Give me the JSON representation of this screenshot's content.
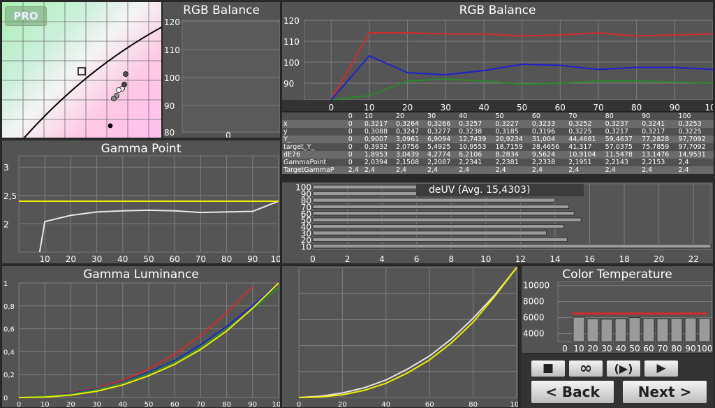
{
  "badge": "PRO",
  "rgb_small": {
    "title": "RGB Balance",
    "yticks": [
      "120",
      "110",
      "100",
      "90",
      "80"
    ],
    "xtick": "0"
  },
  "rgb_big": {
    "title": "RGB Balance",
    "yticks": [
      "120",
      "110",
      "100",
      "90"
    ],
    "xticks": [
      "0",
      "10",
      "20",
      "30",
      "40",
      "50",
      "60",
      "70",
      "80",
      "90",
      "100"
    ],
    "colors": {
      "red": "#d42a2a",
      "green": "#2a8a2a",
      "blue": "#1f1fcf"
    },
    "chart_data": {
      "type": "line",
      "x": [
        0,
        10,
        20,
        30,
        40,
        50,
        60,
        70,
        80,
        90,
        100
      ],
      "series": [
        {
          "color": "red",
          "values": [
            75,
            114,
            114,
            113.5,
            113.5,
            112.5,
            113,
            114,
            112.5,
            113,
            113.5
          ]
        },
        {
          "color": "green",
          "values": [
            75,
            84,
            91,
            92,
            91,
            89.5,
            90,
            91,
            91,
            90.5,
            90
          ]
        },
        {
          "color": "blue",
          "values": [
            75,
            103,
            95,
            94,
            96,
            99,
            98.5,
            96.5,
            97.5,
            97.5,
            96.5
          ]
        }
      ],
      "ylim": [
        80,
        120
      ]
    }
  },
  "stats": {
    "header": [
      "",
      "0",
      "10",
      "20",
      "30",
      "40",
      "50",
      "60",
      "70",
      "80",
      "90",
      "100"
    ],
    "rows": [
      [
        "x",
        "0",
        "0,3217",
        "0,3264",
        "0,3266",
        "0,3257",
        "0,3227",
        "0,3233",
        "0,3252",
        "0,3237",
        "0,3241",
        "0,3253"
      ],
      [
        "y",
        "0",
        "0,3088",
        "0,3247",
        "0,3277",
        "0,3238",
        "0,3185",
        "0,3196",
        "0,3225",
        "0,3217",
        "0,3217",
        "0,3225"
      ],
      [
        "Y_",
        "0",
        "0,9007",
        "3,0961",
        "6,9094",
        "12,7439",
        "20,9234",
        "31,004",
        "44,4681",
        "59,4637",
        "77,2828",
        "97,7092"
      ],
      [
        "target_Y_",
        "0",
        "0,3932",
        "2,0756",
        "5,4925",
        "10,9553",
        "18,7159",
        "28,4656",
        "41,317",
        "57,0375",
        "75,7859",
        "97,7092"
      ],
      [
        "dE76",
        "0",
        "1,8953",
        "3,0439",
        "4,2774",
        "6,2106",
        "8,2834",
        "9,5624",
        "10,9104",
        "11,5478",
        "13,1476",
        "14,9531"
      ],
      [
        "GammaPoint",
        "0",
        "2,0394",
        "2,1508",
        "2,2087",
        "2,2341",
        "2,2381",
        "2,2338",
        "2,1951",
        "2,2143",
        "2,2153",
        "2,4"
      ],
      [
        "TargetGammaP",
        "2,4",
        "2,4",
        "2,4",
        "2,4",
        "2,4",
        "2,4",
        "2,4",
        "2,4",
        "2,4",
        "2,4",
        "2,4"
      ]
    ]
  },
  "deuv": {
    "title": "deUV (Avg. 15,4303)",
    "yticks": [
      "100",
      "90",
      "80",
      "70",
      "60",
      "50",
      "40",
      "30",
      "20",
      "10"
    ],
    "xticks": [
      "0",
      "2",
      "4",
      "6",
      "8",
      "10",
      "12",
      "14",
      "16",
      "18",
      "20",
      "22"
    ],
    "chart_data": {
      "type": "bar",
      "categories": [
        "100",
        "90",
        "80",
        "70",
        "60",
        "50",
        "40",
        "30",
        "20",
        "10"
      ],
      "values": [
        10.3,
        10.3,
        14,
        14.8,
        15.1,
        15.5,
        14.5,
        13.5,
        14.7,
        23
      ],
      "xlim": [
        0,
        23
      ]
    }
  },
  "gamma_point": {
    "title": "Gamma Point",
    "yticks": [
      "3",
      "2,5",
      "2"
    ],
    "xticks": [
      "10",
      "20",
      "30",
      "40",
      "50",
      "60",
      "70",
      "80",
      "90",
      "100"
    ],
    "chart_data": {
      "type": "line",
      "x": [
        8,
        10,
        20,
        30,
        40,
        50,
        60,
        70,
        80,
        90,
        100
      ],
      "series": [
        {
          "name": "",
          "color": "#e8e8e8",
          "values": [
            1.5,
            2.04,
            2.15,
            2.21,
            2.23,
            2.24,
            2.23,
            2.2,
            2.21,
            2.22,
            2.4
          ]
        },
        {
          "name": "",
          "color": "#f0f000",
          "values": [
            2.4,
            2.4,
            2.4,
            2.4,
            2.4,
            2.4,
            2.4,
            2.4,
            2.4,
            2.4,
            2.4
          ]
        }
      ],
      "ylim": [
        1.5,
        3.2
      ],
      "xlim": [
        0,
        100
      ]
    }
  },
  "gamma_lum": {
    "title": "Gamma Luminance",
    "yticks": [
      "1",
      "0,8",
      "0,6",
      "0,4",
      "0,2",
      "0"
    ],
    "xticks": [
      "0",
      "10",
      "20",
      "30",
      "40",
      "50",
      "60",
      "70",
      "80",
      "90",
      "100"
    ],
    "chart_data": {
      "type": "line",
      "x": [
        0,
        10,
        20,
        30,
        40,
        50,
        60,
        70,
        80,
        90,
        100
      ],
      "series": [
        {
          "color": "#d42a2a",
          "values": [
            0,
            0.01,
            0.04,
            0.08,
            0.15,
            0.25,
            0.38,
            0.54,
            0.74,
            0.97,
            1.2
          ]
        },
        {
          "color": "#1f1fcf",
          "values": [
            0,
            0.01,
            0.035,
            0.075,
            0.135,
            0.22,
            0.32,
            0.46,
            0.62,
            0.8,
            1.0
          ]
        },
        {
          "color": "#2a8a2a",
          "values": [
            0,
            0.01,
            0.03,
            0.07,
            0.13,
            0.21,
            0.31,
            0.44,
            0.6,
            0.77,
            0.96
          ]
        },
        {
          "color": "#f0f000",
          "values": [
            0,
            0.004,
            0.021,
            0.055,
            0.11,
            0.19,
            0.29,
            0.42,
            0.58,
            0.78,
            1.0
          ]
        }
      ],
      "ylim": [
        0,
        1
      ],
      "xlim": [
        0,
        100
      ]
    }
  },
  "lum2": {
    "xticks": [
      "0",
      "20",
      "40",
      "60",
      "80",
      "100"
    ],
    "chart_data": {
      "type": "line",
      "x": [
        0,
        10,
        20,
        30,
        40,
        50,
        60,
        70,
        80,
        90,
        100
      ],
      "series": [
        {
          "color": "#e8e8e8",
          "values": [
            0,
            0.01,
            0.035,
            0.075,
            0.135,
            0.22,
            0.32,
            0.45,
            0.61,
            0.79,
            1.0
          ]
        },
        {
          "color": "#f0f000",
          "values": [
            0,
            0.004,
            0.021,
            0.055,
            0.11,
            0.19,
            0.29,
            0.42,
            0.58,
            0.78,
            1.0
          ]
        }
      ],
      "ylim": [
        0,
        1
      ],
      "xlim": [
        0,
        100
      ]
    }
  },
  "color_temp": {
    "title": "Color Temperature",
    "yticks": [
      "10000",
      "8000",
      "6000",
      "4000"
    ],
    "xticks": [
      "0",
      "10",
      "20",
      "30",
      "40",
      "50",
      "60",
      "70",
      "80",
      "90",
      "100"
    ],
    "chart_data": {
      "type": "bar",
      "categories": [
        "10",
        "20",
        "30",
        "40",
        "50",
        "60",
        "70",
        "80",
        "90",
        "100"
      ],
      "values": [
        6050,
        5850,
        5800,
        5850,
        6000,
        5900,
        5850,
        5900,
        5950,
        5900
      ],
      "target": 6500,
      "ylim": [
        3000,
        10500
      ]
    }
  },
  "controls": {
    "stop": "■",
    "loop": "∞",
    "play_cont": "(▶)",
    "play": "▶",
    "back": "< Back",
    "next": "Next >"
  }
}
